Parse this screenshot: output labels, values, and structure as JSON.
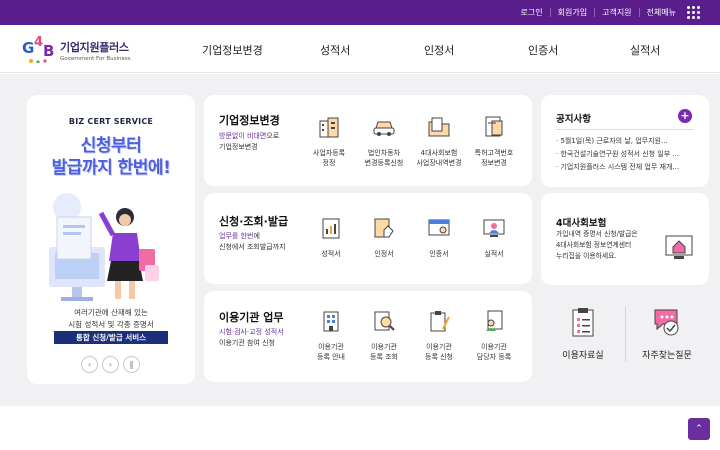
{
  "topbar": {
    "login": "로그인",
    "signup": "회원가입",
    "support": "고객지원",
    "all_menu": "전체메뉴"
  },
  "logo": {
    "title": "기업지원플러스",
    "subtitle": "Government For Business"
  },
  "nav": [
    "기업정보변경",
    "성적서",
    "인정서",
    "인증서",
    "실적서"
  ],
  "banner": {
    "eyebrow": "BIZ CERT SERVICE",
    "headline1": "신청부터",
    "headline2": "발급까지 한번에!",
    "desc1": "여러기관에 산재해 있는",
    "desc2": "시험 성적서 및 각종 증명서",
    "cta": "통합 신청/발급 서비스"
  },
  "cards": [
    {
      "title": "기업정보변경",
      "sub_accent": "방문없이 비대면",
      "sub_rest": "으로",
      "sub2": "기업정보변경",
      "items": [
        {
          "line1": "사업자등록",
          "line2": "정정",
          "icon": "building-edit-icon"
        },
        {
          "line1": "법인차동차",
          "line2": "변경등록신청",
          "icon": "car-icon"
        },
        {
          "line1": "4대사회보험",
          "line2": "사업장내역변경",
          "icon": "folder-edit-icon"
        },
        {
          "line1": "특허고객번호",
          "line2": "정보변경",
          "icon": "patent-doc-icon"
        }
      ]
    },
    {
      "title": "신청·조회·발급",
      "sub_accent": "업무를 한번",
      "sub_rest": "에",
      "sub2": "신청에서 조회발급까지",
      "items": [
        {
          "line1": "성적서",
          "line2": "",
          "icon": "chart-doc-icon"
        },
        {
          "line1": "인정서",
          "line2": "",
          "icon": "approval-doc-icon"
        },
        {
          "line1": "인증서",
          "line2": "",
          "icon": "certificate-icon"
        },
        {
          "line1": "실적서",
          "line2": "",
          "icon": "monitor-person-icon"
        }
      ]
    },
    {
      "title": "이용기관 업무",
      "sub_accent": "시험·검사·교정 성적서",
      "sub_rest": "",
      "sub2": "이용기관 참여 신청",
      "items": [
        {
          "line1": "이용기관",
          "line2": "등록 안내",
          "icon": "office-building-icon"
        },
        {
          "line1": "이용기관",
          "line2": "등록 조회",
          "icon": "search-doc-icon"
        },
        {
          "line1": "이용기관",
          "line2": "등록 신청",
          "icon": "clipboard-pen-icon"
        },
        {
          "line1": "이용기관",
          "line2": "담당자 등록",
          "icon": "person-doc-icon"
        }
      ]
    }
  ],
  "notice": {
    "title": "공지사항",
    "items": [
      "5월1일(목) 근로자의 날, 업무지원...",
      "한국건설기술연구원 성적서 신청 일부 ...",
      "기업지원플러스 시스템 전체 업무 재개..."
    ]
  },
  "insurance": {
    "title": "4대사회보험",
    "desc1": "가입내역 증명서 신청/발급은",
    "desc2": "4대사회보험 정보연계센터",
    "desc3": "누리집을 이용하세요."
  },
  "quick": {
    "guide": "이용자료실",
    "faq": "자주찾는질문"
  },
  "to_top": "⌃",
  "colors": {
    "brand_purple": "#5a1e8c",
    "accent_purple": "#7b2ab0",
    "banner_blue": "#4d5fe0",
    "panel_bg": "#f1f1f3"
  }
}
